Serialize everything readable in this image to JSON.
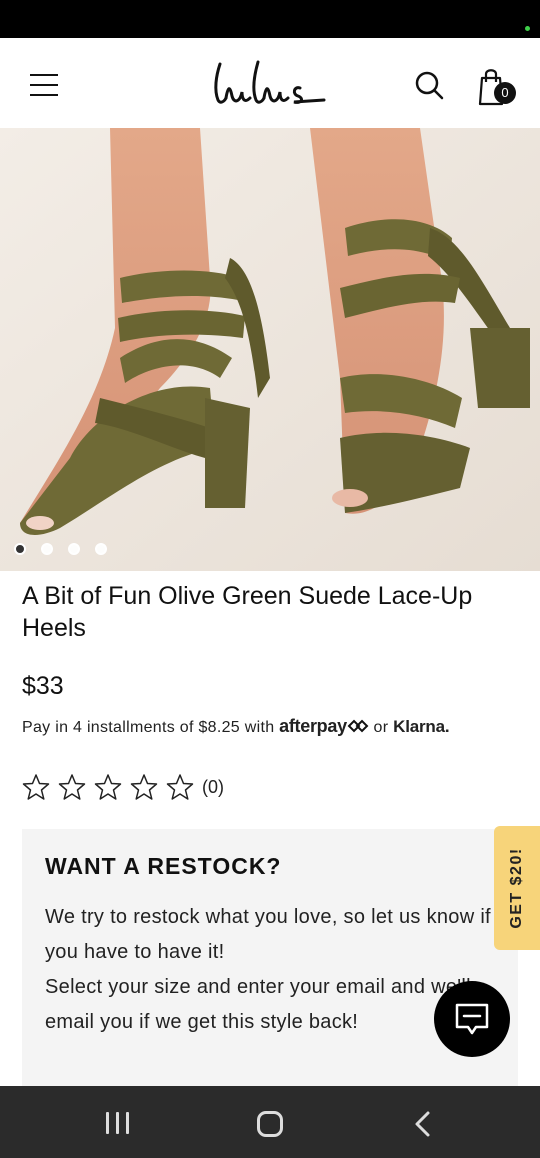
{
  "header": {
    "logo_text": "Lulus",
    "menu_icon": "hamburger-menu-icon",
    "search_icon": "search-icon",
    "bag_icon": "shopping-bag-icon",
    "bag_count": "0"
  },
  "hero": {
    "image_description": "olive green suede lace-up block heels",
    "carousel_total": 4,
    "carousel_active": 1
  },
  "product": {
    "title": "A Bit of Fun Olive Green Suede Lace-Up Heels",
    "price": "$33",
    "installments_prefix": "Pay in 4 installments of $8.25 with",
    "afterpay_label": "afterpay",
    "or_label": "or",
    "klarna_label": "Klarna."
  },
  "rating": {
    "stars": 0,
    "max_stars": 5,
    "count": "(0)"
  },
  "restock": {
    "title": "WANT A RESTOCK?",
    "line1": "We try to restock what you love, so let us know if you have to have it!",
    "line2": "Select your size and enter your email and we'll email you if we get this style back!"
  },
  "promo": {
    "label": "GET $20!",
    "color": "#f7d47a"
  },
  "chat": {
    "icon": "chat-icon"
  },
  "colors": {
    "status_bar": "#000000",
    "nav_bar": "#2b2b2b",
    "restock_bg": "#f4f4f4",
    "olive_suede": "#6f6a36"
  }
}
